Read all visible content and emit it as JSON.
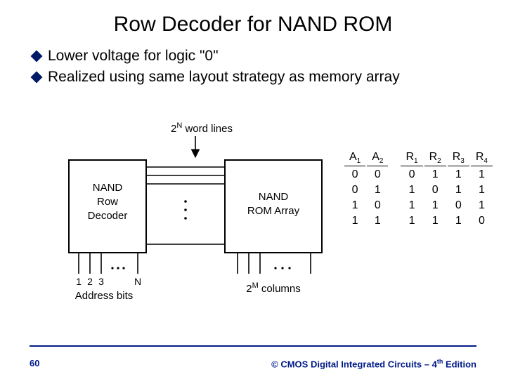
{
  "title": "Row Decoder for NAND ROM",
  "bullets": [
    "Lower voltage for logic \"0\"",
    "Realized using same layout strategy as memory array"
  ],
  "diagram": {
    "top_label": "2",
    "top_label_sup": "N",
    "top_label_tail": " word lines",
    "left_block_l1": "NAND",
    "left_block_l2": "Row",
    "left_block_l3": "Decoder",
    "right_block_l1": "NAND",
    "right_block_l2": "ROM Array",
    "addr_ticks": [
      "1",
      "2",
      "3",
      "N"
    ],
    "addr_caption": "Address bits",
    "cols_label": "2",
    "cols_label_sup": "M",
    "cols_label_tail": " columns"
  },
  "table": {
    "headers_A": [
      "A",
      "A"
    ],
    "headers_A_sub": [
      "1",
      "2"
    ],
    "headers_R": [
      "R",
      "R",
      "R",
      "R"
    ],
    "headers_R_sub": [
      "1",
      "2",
      "3",
      "4"
    ],
    "rows": [
      {
        "a": [
          "0",
          "0"
        ],
        "r": [
          "0",
          "1",
          "1",
          "1"
        ]
      },
      {
        "a": [
          "0",
          "1"
        ],
        "r": [
          "1",
          "0",
          "1",
          "1"
        ]
      },
      {
        "a": [
          "1",
          "0"
        ],
        "r": [
          "1",
          "1",
          "0",
          "1"
        ]
      },
      {
        "a": [
          "1",
          "1"
        ],
        "r": [
          "1",
          "1",
          "1",
          "0"
        ]
      }
    ]
  },
  "footer": {
    "page": "60",
    "copyright_pre": "© CMOS Digital Integrated Circuits – 4",
    "copyright_sup": "th",
    "copyright_post": " Edition"
  }
}
